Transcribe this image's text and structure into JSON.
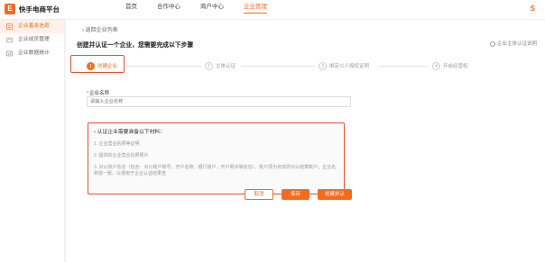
{
  "header": {
    "logo_letter": "E",
    "brand": "快手电商平台",
    "nav": [
      "首页",
      "合作中心",
      "商户中心",
      "企业管理"
    ],
    "user_initial": "S"
  },
  "sidebar": {
    "items": [
      {
        "label": "企业基本信息",
        "icon": "building-icon"
      },
      {
        "label": "企业成员管理",
        "icon": "members-icon"
      },
      {
        "label": "企业数据统计",
        "icon": "chart-icon"
      }
    ]
  },
  "main": {
    "back": "返回企业列表",
    "title": "创建并认证一个企业，您需要完成以下步骤",
    "help": "企业主体认证说明",
    "steps": [
      {
        "num": "1",
        "label": "创建企业"
      },
      {
        "num": "2",
        "label": "主体认证"
      },
      {
        "num": "3",
        "label": "绑定以人授权证明"
      },
      {
        "num": "4",
        "label": "开启经营权"
      }
    ],
    "form": {
      "label": "企业名称",
      "placeholder": "请输入企业名称"
    },
    "info": {
      "title": "认证企业需要准备以下材料：",
      "lines": [
        "1. 企业营业执照等证明",
        "2. 提供的企业营业执照照片",
        "3. 对公账户信息（包含：对公账户账号、开户名称、银行账户、开户网点等信息）。账户须为有效的对公结算账户，企业名称需一致，以便用于企业认证结果查"
      ]
    },
    "buttons": {
      "cancel": "取消",
      "save": "保存",
      "create": "创建并认证"
    }
  },
  "colors": {
    "accent": "#f36b21",
    "highlight": "#e2542e"
  }
}
